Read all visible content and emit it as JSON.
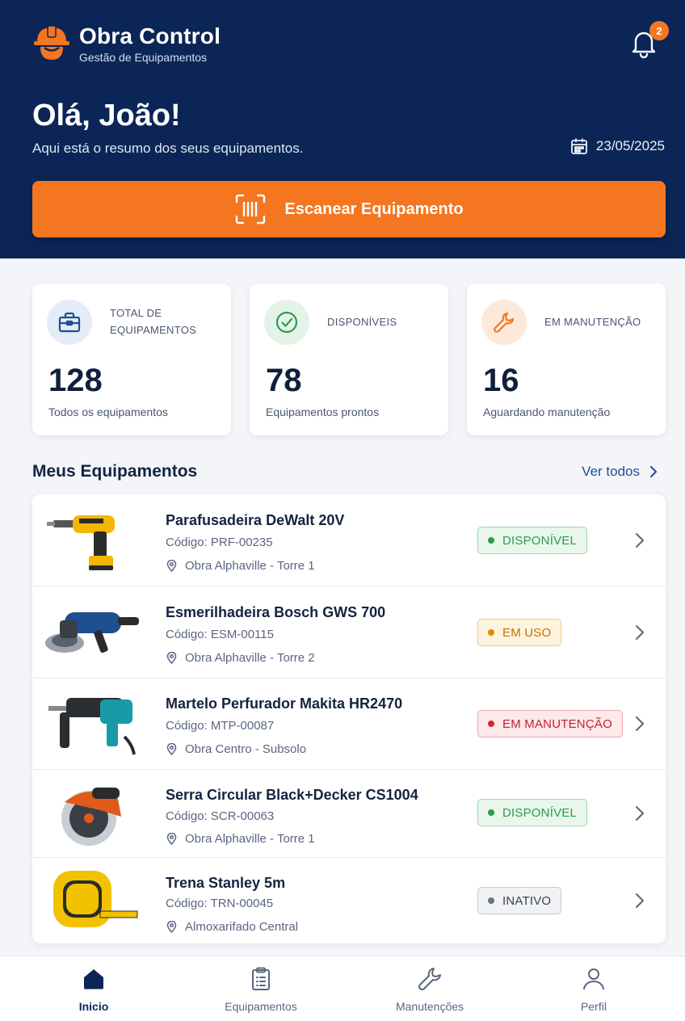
{
  "header": {
    "app_name": "Obra Control",
    "app_subtitle": "Gestão de Equipamentos",
    "notification_count": "2",
    "greeting": "Olá, João!",
    "greeting_subtitle": "Aqui está o resumo dos seus equipamentos.",
    "date": "23/05/2025",
    "scan_label": "Escanear Equipamento"
  },
  "stats": [
    {
      "label_line1": "TOTAL DE",
      "label_line2": "EQUIPAMENTOS",
      "value": "128",
      "description": "Todos os equipamentos",
      "icon": "toolbox-icon",
      "color": "#1f4f93"
    },
    {
      "label": "DISPONÍVEIS",
      "value": "78",
      "description": "Equipamentos prontos",
      "icon": "check-circle-icon",
      "color": "#2e9a4e"
    },
    {
      "label": "EM MANUTENÇÃO",
      "value": "16",
      "description": "Aguardando manutenção",
      "icon": "wrench-icon",
      "color": "#f47620"
    }
  ],
  "section": {
    "title": "Meus Equipamentos",
    "see_all": "Ver todos"
  },
  "equipment": [
    {
      "name": "Parafusadeira DeWalt 20V",
      "code": "Código: PRF-00235",
      "location": "Obra Alphaville - Torre 1",
      "status": "DISPONÍVEL",
      "status_color": "#2e9a4e"
    },
    {
      "name": "Esmerilhadeira Bosch GWS 700",
      "code": "Código: ESM-00115",
      "location": "Obra Alphaville - Torre 2",
      "status": "EM USO",
      "status_color": "#e08a00"
    },
    {
      "name": "Martelo Perfurador Makita HR2470",
      "code": "Código: MTP-00087",
      "location": "Obra Centro - Subsolo",
      "status": "EM MANUTENÇÃO",
      "status_color": "#d3283a"
    },
    {
      "name": "Serra Circular Black+Decker CS1004",
      "code": "Código: SCR-00063",
      "location": "Obra Alphaville - Torre 1",
      "status": "DISPONÍVEL",
      "status_color": "#2e9a4e"
    },
    {
      "name": "Trena Stanley 5m",
      "code": "Código: TRN-00045",
      "location": "Almoxarifado Central",
      "status": "INATIVO",
      "status_color": "#6b7280"
    }
  ],
  "nav": {
    "home": "Inicio",
    "equipment": "Equipamentos",
    "maintenance": "Manutenções",
    "profile": "Perfil"
  },
  "colors": {
    "primary": "#0b2656",
    "accent": "#f47620"
  }
}
